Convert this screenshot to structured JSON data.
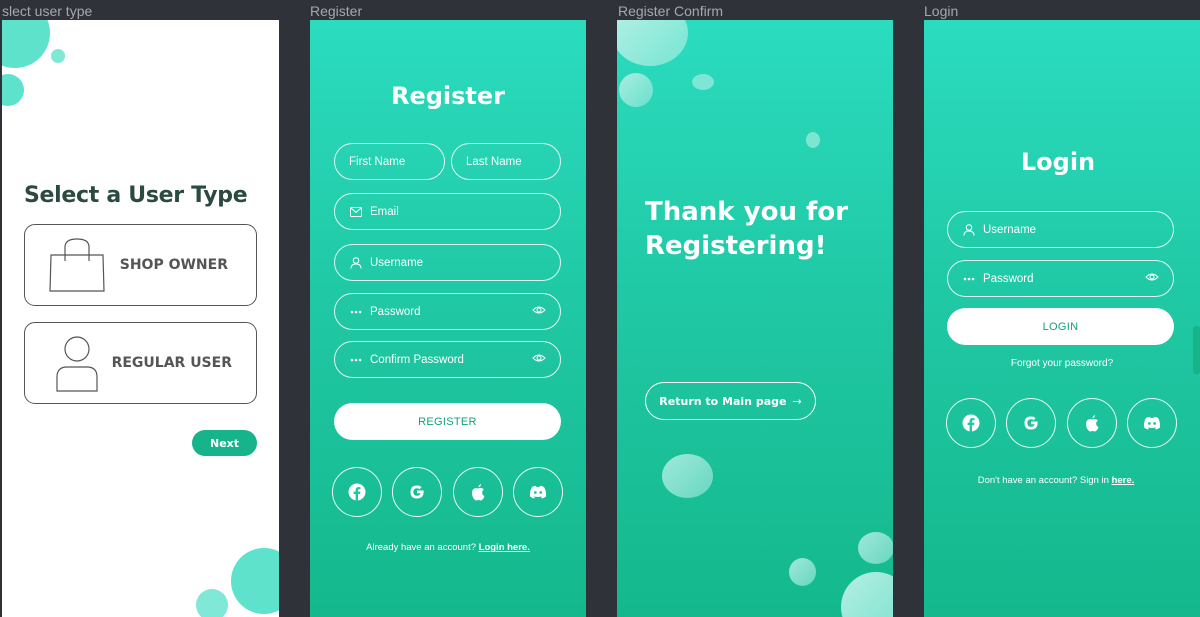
{
  "labels": {
    "f1": "slect user type",
    "f2": "Register",
    "f3": "Register Confirm",
    "f4": "Login"
  },
  "select_type": {
    "title": "Select a User Type",
    "shop_owner": "SHOP OWNER",
    "regular_user": "REGULAR USER",
    "next": "Next"
  },
  "register": {
    "title": "Register",
    "first_name": "First Name",
    "last_name": "Last Name",
    "email": "Email",
    "username": "Username",
    "password": "Password",
    "confirm_password": "Confirm Password",
    "button": "REGISTER",
    "footer_text": "Already have an account?",
    "footer_link": "Login here."
  },
  "confirm": {
    "title": "Thank you for Registering!",
    "return_button": "Return to Main page",
    "arrow": "→"
  },
  "login": {
    "title": "Login",
    "username": "Username",
    "password": "Password",
    "button": "LOGIN",
    "forgot": "Forgot your password?",
    "footer_text": "Don't have an account? Sign in",
    "footer_link": "here."
  },
  "social_icons": [
    "facebook-icon",
    "google-icon",
    "apple-icon",
    "discord-icon"
  ],
  "colors": {
    "accent": "#17b38a",
    "gradient_top": "#2bdcbf",
    "gradient_bottom": "#14b88c",
    "bubble": "#5ee2cc",
    "title_dark": "#2d4a42",
    "canvas": "#2f3238"
  }
}
